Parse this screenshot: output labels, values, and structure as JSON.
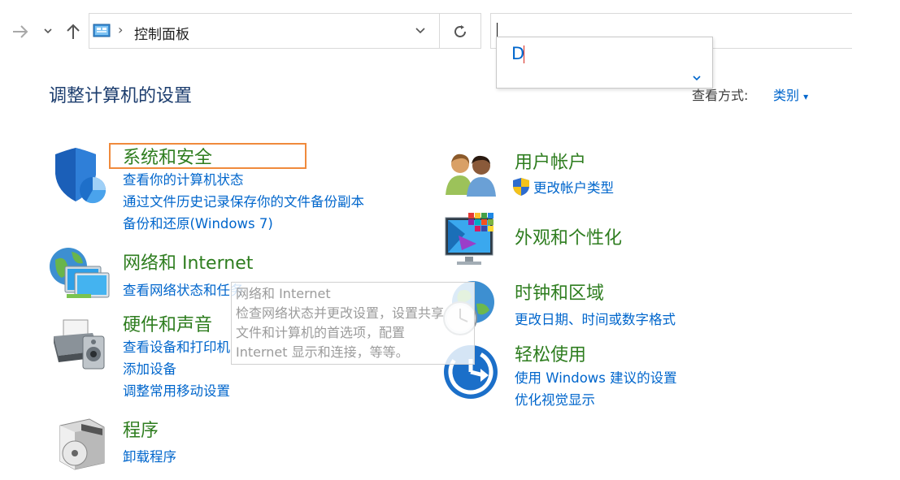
{
  "nav": {
    "forward_icon": "arrow-right-icon",
    "history_icon": "chevron-down-icon",
    "up_icon": "arrow-up-icon"
  },
  "address": {
    "path": "控制面板",
    "separator": "›",
    "refresh_icon": "refresh-icon"
  },
  "search": {
    "value": ""
  },
  "autocomplete": {
    "typed": "D"
  },
  "page_title": "调整计算机的设置",
  "view_by": {
    "label": "查看方式:",
    "value": "类别",
    "arrow": "▾"
  },
  "categories": [
    {
      "title": "系统和安全",
      "icon": "shield-icon",
      "links": [
        "查看你的计算机状态",
        "通过文件历史记录保存你的文件备份副本",
        "备份和还原(Windows 7)"
      ]
    },
    {
      "title": "网络和 Internet",
      "icon": "network-icon",
      "links": [
        "查看网络状态和任务"
      ]
    },
    {
      "title": "硬件和声音",
      "icon": "printer-icon",
      "links": [
        "查看设备和打印机",
        "添加设备",
        "调整常用移动设置"
      ]
    },
    {
      "title": "程序",
      "icon": "programs-icon",
      "links": [
        "卸载程序"
      ]
    },
    {
      "title": "用户帐户",
      "icon": "users-icon",
      "links": [
        "更改帐户类型"
      ]
    },
    {
      "title": "外观和个性化",
      "icon": "appearance-icon",
      "links": []
    },
    {
      "title": "时钟和区域",
      "icon": "clock-globe-icon",
      "links": [
        "更改日期、时间或数字格式"
      ]
    },
    {
      "title": "轻松使用",
      "icon": "ease-of-access-icon",
      "links": [
        "使用 Windows 建议的设置",
        "优化视觉显示"
      ]
    }
  ],
  "tooltip": {
    "lines": [
      "网络和 Internet",
      "检查网络状态并更改设置，设置共享",
      "文件和计算机的首选项，配置",
      "Internet 显示和连接，等等。"
    ]
  },
  "colors": {
    "category_title": "#2e7d1f",
    "link": "#0066cc",
    "focus": "#f08a3c"
  }
}
